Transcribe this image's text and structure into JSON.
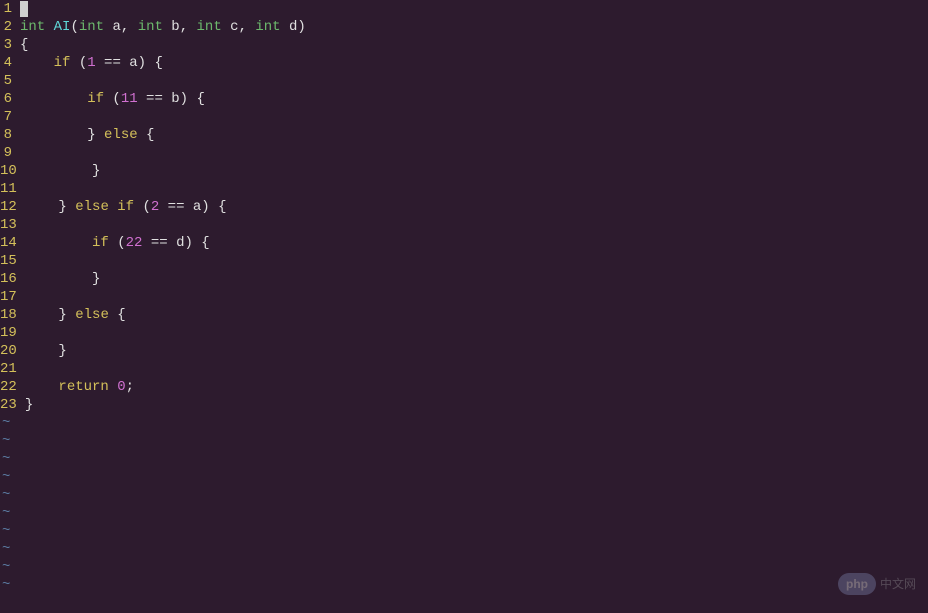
{
  "editor": {
    "lines": [
      {
        "num": "1",
        "tokens": [
          {
            "t": "cursor",
            "v": " "
          }
        ]
      },
      {
        "num": "2",
        "tokens": [
          {
            "t": "kw-type",
            "v": "int"
          },
          {
            "t": "punct",
            "v": " "
          },
          {
            "t": "fn-name",
            "v": "AI"
          },
          {
            "t": "punct",
            "v": "("
          },
          {
            "t": "kw-type",
            "v": "int"
          },
          {
            "t": "param",
            "v": " a"
          },
          {
            "t": "punct",
            "v": ", "
          },
          {
            "t": "kw-type",
            "v": "int"
          },
          {
            "t": "param",
            "v": " b"
          },
          {
            "t": "punct",
            "v": ", "
          },
          {
            "t": "kw-type",
            "v": "int"
          },
          {
            "t": "param",
            "v": " c"
          },
          {
            "t": "punct",
            "v": ", "
          },
          {
            "t": "kw-type",
            "v": "int"
          },
          {
            "t": "param",
            "v": " d"
          },
          {
            "t": "punct",
            "v": ")"
          }
        ]
      },
      {
        "num": "3",
        "tokens": [
          {
            "t": "punct",
            "v": "{"
          }
        ]
      },
      {
        "num": "4",
        "tokens": [
          {
            "t": "punct",
            "v": "    "
          },
          {
            "t": "kw-ctrl",
            "v": "if"
          },
          {
            "t": "punct",
            "v": " ("
          },
          {
            "t": "num",
            "v": "1"
          },
          {
            "t": "op",
            "v": " == "
          },
          {
            "t": "param",
            "v": "a"
          },
          {
            "t": "punct",
            "v": ") {"
          }
        ]
      },
      {
        "num": "5",
        "tokens": []
      },
      {
        "num": "6",
        "tokens": [
          {
            "t": "punct",
            "v": "        "
          },
          {
            "t": "kw-ctrl",
            "v": "if"
          },
          {
            "t": "punct",
            "v": " ("
          },
          {
            "t": "num",
            "v": "11"
          },
          {
            "t": "op",
            "v": " == "
          },
          {
            "t": "param",
            "v": "b"
          },
          {
            "t": "punct",
            "v": ") {"
          }
        ]
      },
      {
        "num": "7",
        "tokens": []
      },
      {
        "num": "8",
        "tokens": [
          {
            "t": "punct",
            "v": "        } "
          },
          {
            "t": "kw-ctrl",
            "v": "else"
          },
          {
            "t": "punct",
            "v": " {"
          }
        ]
      },
      {
        "num": "9",
        "tokens": []
      },
      {
        "num": "10",
        "tokens": [
          {
            "t": "punct",
            "v": "        }"
          }
        ]
      },
      {
        "num": "11",
        "tokens": []
      },
      {
        "num": "12",
        "tokens": [
          {
            "t": "punct",
            "v": "    } "
          },
          {
            "t": "kw-ctrl",
            "v": "else"
          },
          {
            "t": "punct",
            "v": " "
          },
          {
            "t": "kw-ctrl",
            "v": "if"
          },
          {
            "t": "punct",
            "v": " ("
          },
          {
            "t": "num",
            "v": "2"
          },
          {
            "t": "op",
            "v": " == "
          },
          {
            "t": "param",
            "v": "a"
          },
          {
            "t": "punct",
            "v": ") {"
          }
        ]
      },
      {
        "num": "13",
        "tokens": []
      },
      {
        "num": "14",
        "tokens": [
          {
            "t": "punct",
            "v": "        "
          },
          {
            "t": "kw-ctrl",
            "v": "if"
          },
          {
            "t": "punct",
            "v": " ("
          },
          {
            "t": "num",
            "v": "22"
          },
          {
            "t": "op",
            "v": " == "
          },
          {
            "t": "param",
            "v": "d"
          },
          {
            "t": "punct",
            "v": ") {"
          }
        ]
      },
      {
        "num": "15",
        "tokens": []
      },
      {
        "num": "16",
        "tokens": [
          {
            "t": "punct",
            "v": "        }"
          }
        ]
      },
      {
        "num": "17",
        "tokens": []
      },
      {
        "num": "18",
        "tokens": [
          {
            "t": "punct",
            "v": "    } "
          },
          {
            "t": "kw-ctrl",
            "v": "else"
          },
          {
            "t": "punct",
            "v": " {"
          }
        ]
      },
      {
        "num": "19",
        "tokens": []
      },
      {
        "num": "20",
        "tokens": [
          {
            "t": "punct",
            "v": "    }"
          }
        ]
      },
      {
        "num": "21",
        "tokens": []
      },
      {
        "num": "22",
        "tokens": [
          {
            "t": "punct",
            "v": "    "
          },
          {
            "t": "kw-ctrl",
            "v": "return"
          },
          {
            "t": "punct",
            "v": " "
          },
          {
            "t": "num",
            "v": "0"
          },
          {
            "t": "punct",
            "v": ";"
          }
        ]
      },
      {
        "num": "23",
        "tokens": [
          {
            "t": "punct",
            "v": "}"
          }
        ]
      }
    ],
    "tilde_count": 10,
    "tilde_char": "~"
  },
  "watermark": {
    "badge": "php",
    "text": "中文网"
  }
}
